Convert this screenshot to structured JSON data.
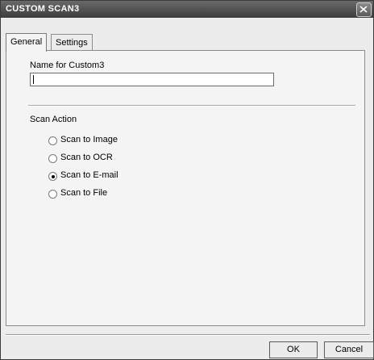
{
  "window": {
    "title": "CUSTOM SCAN3"
  },
  "tabs": [
    {
      "label": "General",
      "active": true
    },
    {
      "label": "Settings",
      "active": false
    }
  ],
  "general": {
    "name_label": "Name for Custom3",
    "name_value": "",
    "scan_action_label": "Scan Action",
    "options": [
      {
        "label": "Scan to Image",
        "checked": false
      },
      {
        "label": "Scan to OCR",
        "checked": false
      },
      {
        "label": "Scan to E-mail",
        "checked": true
      },
      {
        "label": "Scan to File",
        "checked": false
      }
    ]
  },
  "buttons": {
    "ok": "OK",
    "cancel": "Cancel"
  },
  "icons": {
    "close": "close-icon"
  }
}
